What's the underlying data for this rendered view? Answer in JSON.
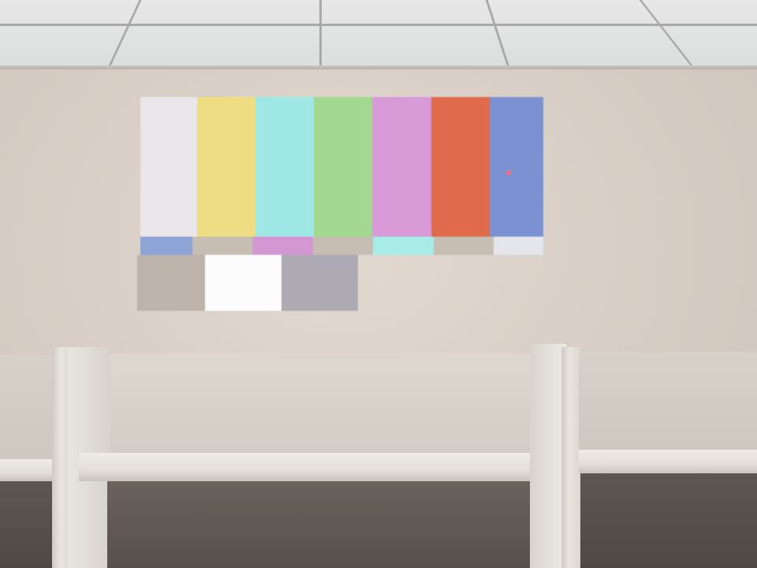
{
  "scene": {
    "description_colors": {
      "wall": "#d8cfc6",
      "ceiling": "#e2e3e2"
    }
  },
  "test_pattern": {
    "top_bars": [
      {
        "color": "#e9e7ea"
      },
      {
        "color": "#eedd82"
      },
      {
        "color": "#9fe8e6"
      },
      {
        "color": "#a3d890"
      },
      {
        "color": "#d99ad8"
      },
      {
        "color": "#df6a4c"
      },
      {
        "color": "#7c91d2"
      }
    ],
    "middle_strip": [
      {
        "color": "#8ea3d6"
      },
      {
        "color": "#c6bdb3"
      },
      {
        "color": "#d497d4"
      },
      {
        "color": "#c6bdb3"
      },
      {
        "color": "#a8ece8"
      },
      {
        "color": "#c6bdb3"
      },
      {
        "color": "#e5e6ec"
      }
    ],
    "bottom_blocks": [
      {
        "color": "#bdb3aa"
      },
      {
        "color": "#fbfcfb"
      },
      {
        "color": "#aeaab4"
      }
    ],
    "pointer_color": "#ff3b55"
  }
}
